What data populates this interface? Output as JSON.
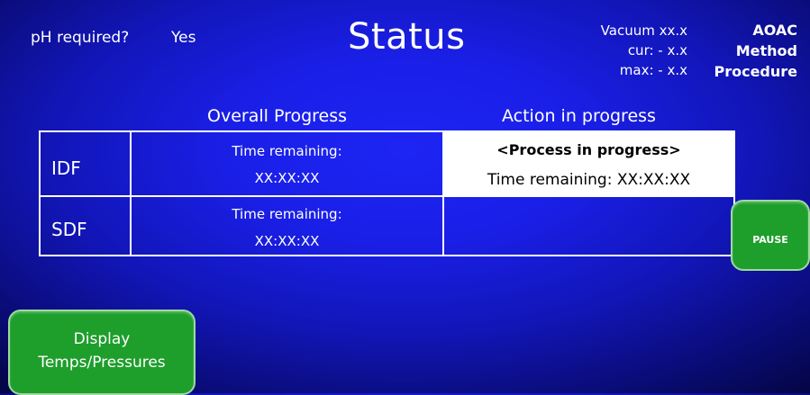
{
  "header": {
    "ph_label": "pH required?",
    "ph_value": "Yes",
    "title": "Status",
    "vacuum_line": "Vacuum  xx.x",
    "cur_line": "cur:  - x.x",
    "max_line": "max:  - x.x",
    "method_line1": "AOAC",
    "method_line2": "Method",
    "method_line3": "Procedure"
  },
  "columns": {
    "overall": "Overall Progress",
    "action": "Action in progress"
  },
  "rows": [
    {
      "label": "IDF",
      "time_label": "Time remaining:",
      "time_value": "XX:XX:XX"
    },
    {
      "label": "SDF",
      "time_label": "Time remaining:",
      "time_value": "XX:XX:XX"
    }
  ],
  "action": {
    "process": "<Process in progress>",
    "time_remaining": "Time remaining: XX:XX:XX"
  },
  "buttons": {
    "pause": "PAUSE",
    "display_line1": "Display",
    "display_line2": "Temps/Pressures"
  },
  "colors": {
    "background": "#1a1fe6",
    "button_green": "#1e9e2b",
    "active_cell": "#ffffff"
  }
}
